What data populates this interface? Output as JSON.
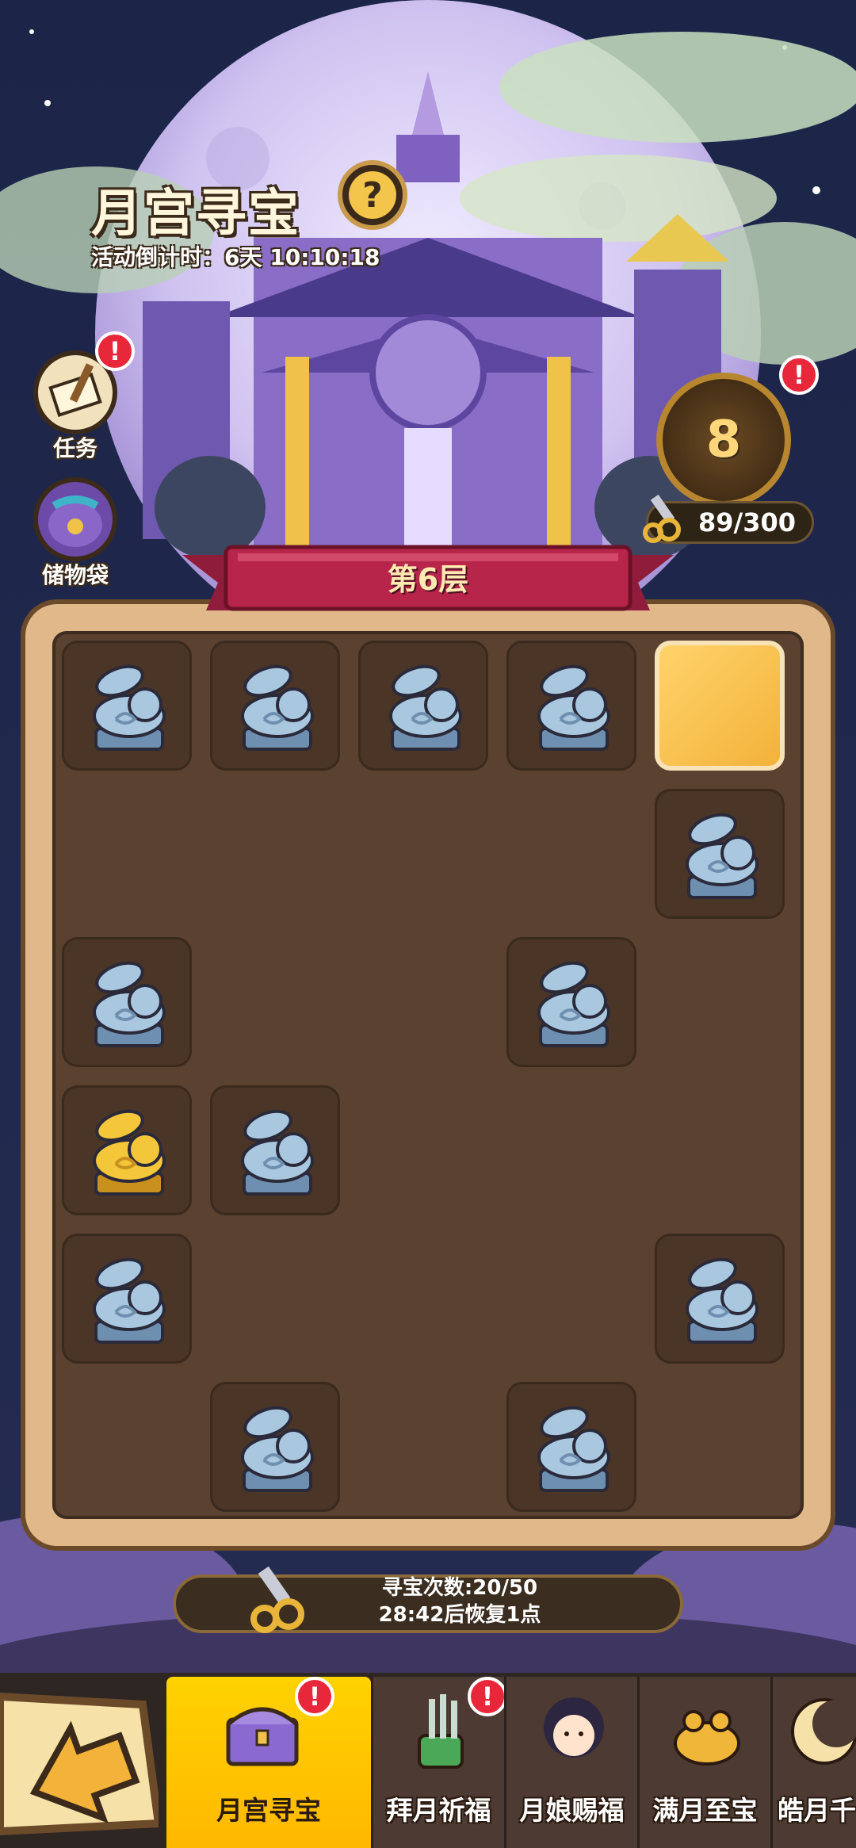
{
  "header": {
    "title": "月宫寻宝",
    "countdown": "活动倒计时：6天 10:10:18",
    "help_glyph": "?"
  },
  "side_buttons": [
    {
      "label": "任务",
      "icon": "scroll-brush-icon",
      "alert": "!"
    },
    {
      "label": "储物袋",
      "icon": "pouch-icon"
    }
  ],
  "level_medal": {
    "value": "8",
    "alert": "!"
  },
  "shovels": {
    "count": "89/300"
  },
  "floor_banner": "第6层",
  "board": {
    "rows": [
      [
        "rabbit",
        "rabbit",
        "rabbit",
        "rabbit",
        "gold-tile"
      ],
      [
        "empty",
        "empty",
        "empty",
        "empty",
        "rabbit"
      ],
      [
        "rabbit",
        "empty",
        "empty",
        "rabbit",
        "empty"
      ],
      [
        "gold-rabbit",
        "rabbit",
        "empty",
        "empty",
        "empty"
      ],
      [
        "rabbit",
        "empty",
        "empty",
        "empty",
        "rabbit"
      ],
      [
        "empty",
        "rabbit",
        "empty",
        "rabbit",
        "empty"
      ]
    ]
  },
  "dig_info": {
    "line1": "寻宝次数:20/50",
    "line2": "28:42后恢复1点"
  },
  "tabs": [
    {
      "label": "月宫寻宝",
      "icon": "treasure-chest-icon",
      "active": true,
      "alert": "!"
    },
    {
      "label": "拜月祈福",
      "icon": "incense-pot-icon",
      "active": false,
      "alert": "!"
    },
    {
      "label": "月娘赐福",
      "icon": "moon-maiden-icon",
      "active": false
    },
    {
      "label": "满月至宝",
      "icon": "golden-toad-icon",
      "active": false
    },
    {
      "label": "皓月千",
      "icon": "moon-rabbit-icon",
      "active": false
    }
  ],
  "colors": {
    "accent_yellow": "#ffc800",
    "board_brown": "#5a4130",
    "alert_red": "#e8283a",
    "banner_red": "#b8254a"
  }
}
